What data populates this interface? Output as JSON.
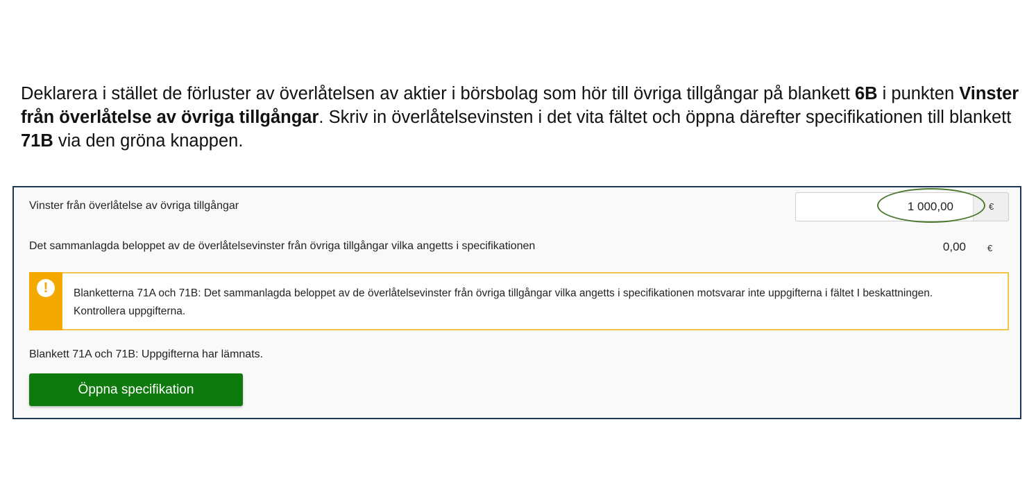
{
  "intro": {
    "part1": "Deklarera i stället de förluster av överlåtelsen av aktier i börsbolag som hör till övriga tillgångar på blankett ",
    "bold1": "6B",
    "part2": " i punkten ",
    "bold2": "Vinster från överlåtelse av övriga tillgångar",
    "part3": ". Skriv in överlåtelsevinsten i det vita fältet och öppna därefter specifikationen till blankett ",
    "bold3": "71B",
    "part4": " via den gröna knappen."
  },
  "form": {
    "gains_label": "Vinster från överlåtelse av övriga tillgångar",
    "gains_value": "1 000,00",
    "currency": "€",
    "total_label": "Det sammanlagda beloppet av de överlåtelsevinster från övriga tillgångar vilka angetts i specifikationen",
    "total_value": "0,00"
  },
  "warning": {
    "icon": "exclamation-circle-icon",
    "text": "Blanketterna 71A och 71B: Det sammanlagda beloppet av de överlåtelsevinster från övriga tillgångar vilka angetts i specifikationen motsvarar inte uppgifterna i fältet I beskattningen. Kontrollera uppgifterna.",
    "accent_color": "#f5a800"
  },
  "status": {
    "text": "Blankett 71A och 71B: Uppgifterna har lämnats."
  },
  "button": {
    "label": "Öppna specifikation",
    "color": "#0e7a0d"
  },
  "colors": {
    "panel_border": "#1f3554",
    "highlight_oval": "#4a7a2e"
  }
}
